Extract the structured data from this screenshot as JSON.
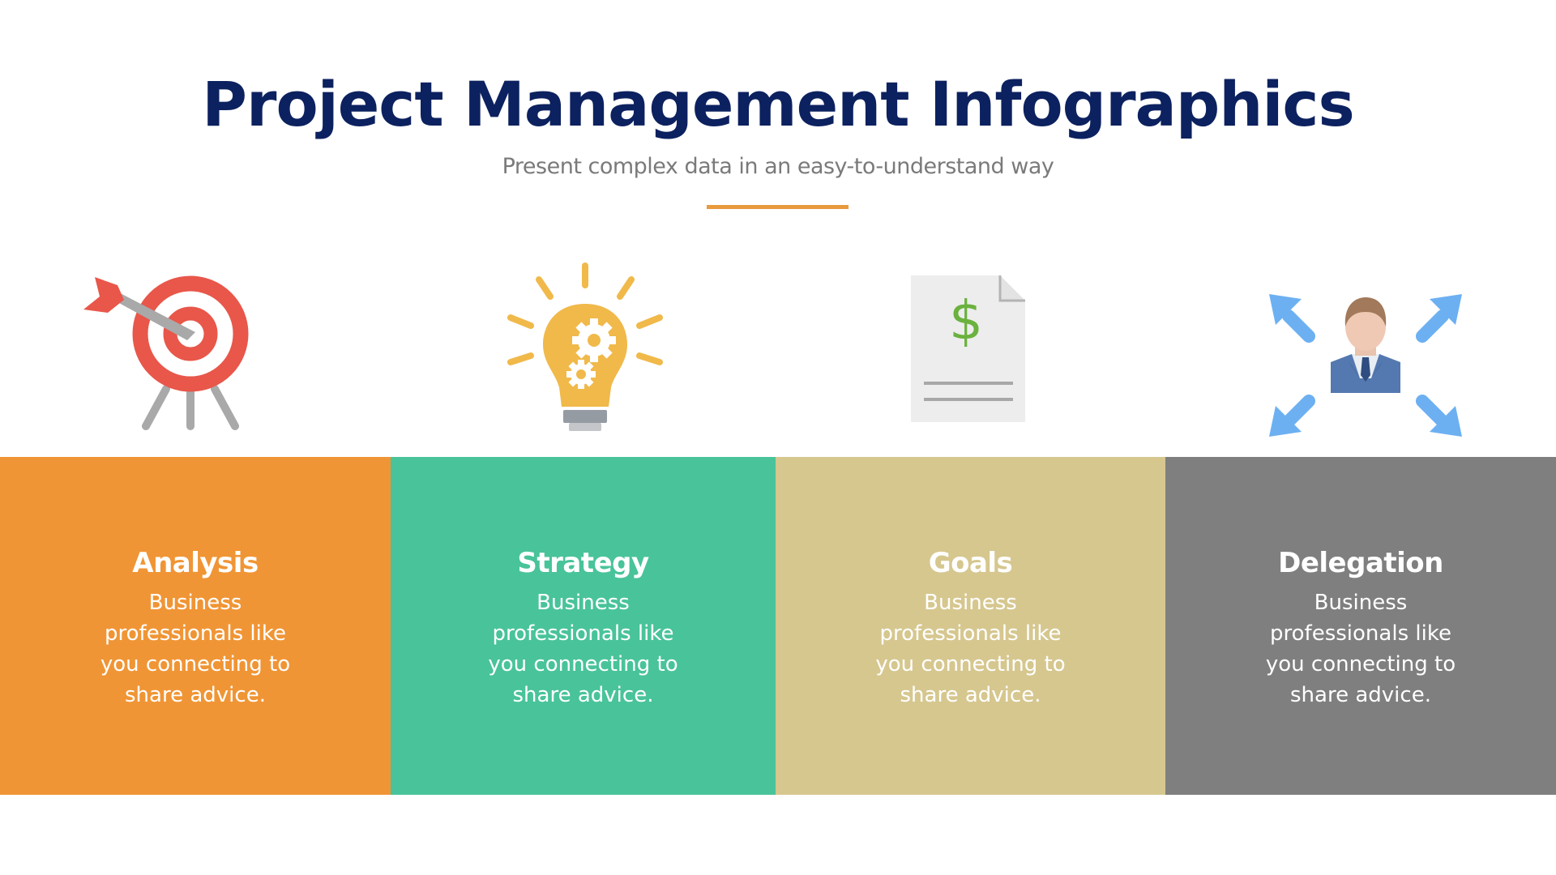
{
  "header": {
    "title": "Project Management Infographics",
    "subtitle": "Present complex data in an easy-to-understand way"
  },
  "colors": {
    "title": "#0c215f",
    "accent_line": "#e89a3d"
  },
  "panels": [
    {
      "icon": "target-arrow-icon",
      "title": "Analysis",
      "body": "Business professionals like you connecting to share advice.",
      "color": "#f09535"
    },
    {
      "icon": "lightbulb-gears-icon",
      "title": "Strategy",
      "body": "Business professionals like you connecting to share advice.",
      "color": "#49c39a"
    },
    {
      "icon": "dollar-document-icon",
      "title": "Goals",
      "body": "Business professionals like you connecting to share advice.",
      "color": "#d6c78f"
    },
    {
      "icon": "person-arrows-icon",
      "title": "Delegation",
      "body": "Business professionals like you connecting to share advice.",
      "color": "#7f7f7f"
    }
  ]
}
